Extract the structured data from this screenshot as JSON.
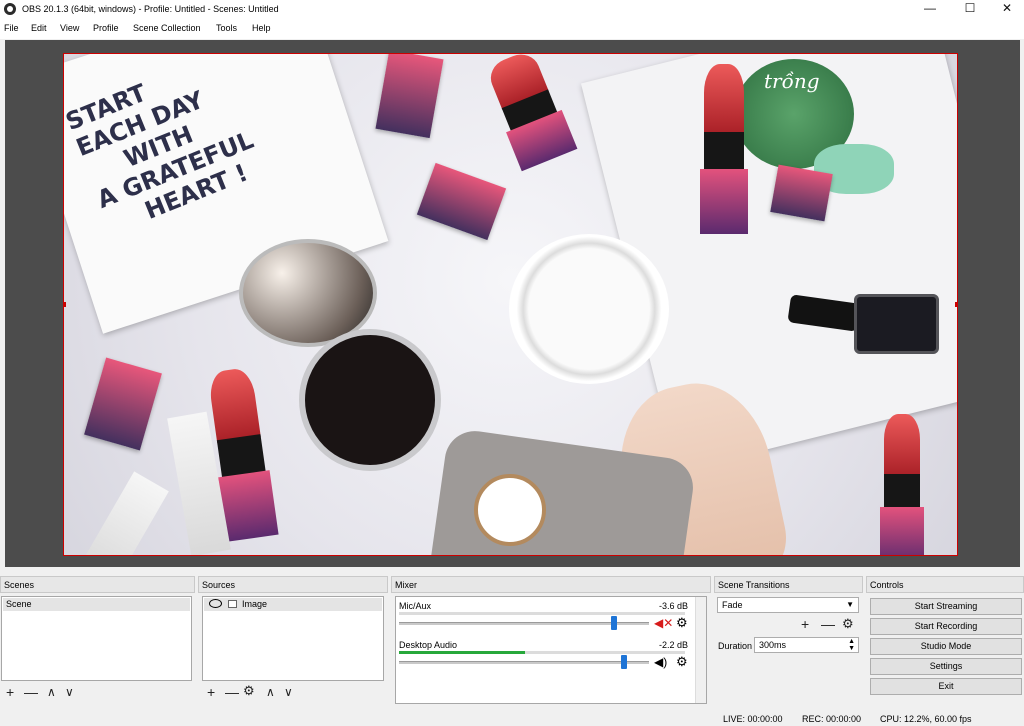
{
  "window": {
    "title": "OBS 20.1.3 (64bit, windows) - Profile: Untitled - Scenes: Untitled",
    "minimize": "—",
    "maximize": "☐",
    "close": "✕"
  },
  "menu": [
    {
      "label": "File"
    },
    {
      "label": "Edit"
    },
    {
      "label": "View"
    },
    {
      "label": "Profile"
    },
    {
      "label": "Scene Collection"
    },
    {
      "label": "Tools"
    },
    {
      "label": "Help"
    }
  ],
  "preview": {
    "card_text": [
      "START",
      "EACH DAY",
      "WITH",
      "A GRATEFUL",
      "HEART !"
    ],
    "tea_text": "trồng"
  },
  "scenes": {
    "header": "Scenes",
    "items": [
      "Scene"
    ],
    "add": "+",
    "remove": "—",
    "up": "∧",
    "down": "∨"
  },
  "sources": {
    "header": "Sources",
    "items": [
      {
        "name": "Image"
      }
    ],
    "add": "+",
    "remove": "—",
    "up": "∧",
    "down": "∨"
  },
  "mixer": {
    "header": "Mixer",
    "channels": [
      {
        "name": "Mic/Aux",
        "db": "-3.6 dB",
        "level": 0.0,
        "volume": 0.82,
        "muted": true
      },
      {
        "name": "Desktop Audio",
        "db": "-2.2 dB",
        "level": 0.4,
        "volume": 0.86,
        "muted": false
      }
    ]
  },
  "transitions": {
    "header": "Scene Transitions",
    "selected": "Fade",
    "add": "+",
    "remove": "—",
    "duration_label": "Duration",
    "duration_value": "300ms"
  },
  "controls": {
    "header": "Controls",
    "start_streaming": "Start Streaming",
    "start_recording": "Start Recording",
    "studio_mode": "Studio Mode",
    "settings": "Settings",
    "exit": "Exit"
  },
  "status": {
    "live": "LIVE: 00:00:00",
    "rec": "REC: 00:00:00",
    "cpu": "CPU: 12.2%, 60.00 fps"
  }
}
